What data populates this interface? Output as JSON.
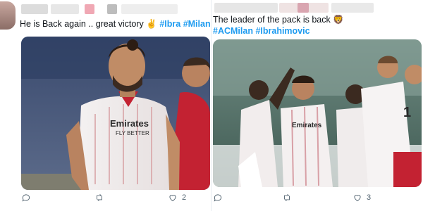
{
  "tweets": [
    {
      "text_plain": "He is Back again .. great victory ",
      "emoji": "✌",
      "hashtags": [
        "#Ibra",
        "#Milan"
      ],
      "actions": {
        "reply": "",
        "retweet": "",
        "like": "2"
      }
    },
    {
      "text_line1": "The leader of the pack is back ",
      "emoji": "🦁",
      "hashtags": [
        "#ACMilan",
        "#Ibrahimovic"
      ],
      "actions": {
        "reply": "",
        "retweet": "",
        "like": "3"
      }
    }
  ],
  "colors": {
    "link": "#1d9bf0",
    "icon": "#536471",
    "divider": "#e6ecf0"
  },
  "jersey_text": {
    "sponsor": "Emirates",
    "sponsor_sub": "FLY BETTER"
  }
}
